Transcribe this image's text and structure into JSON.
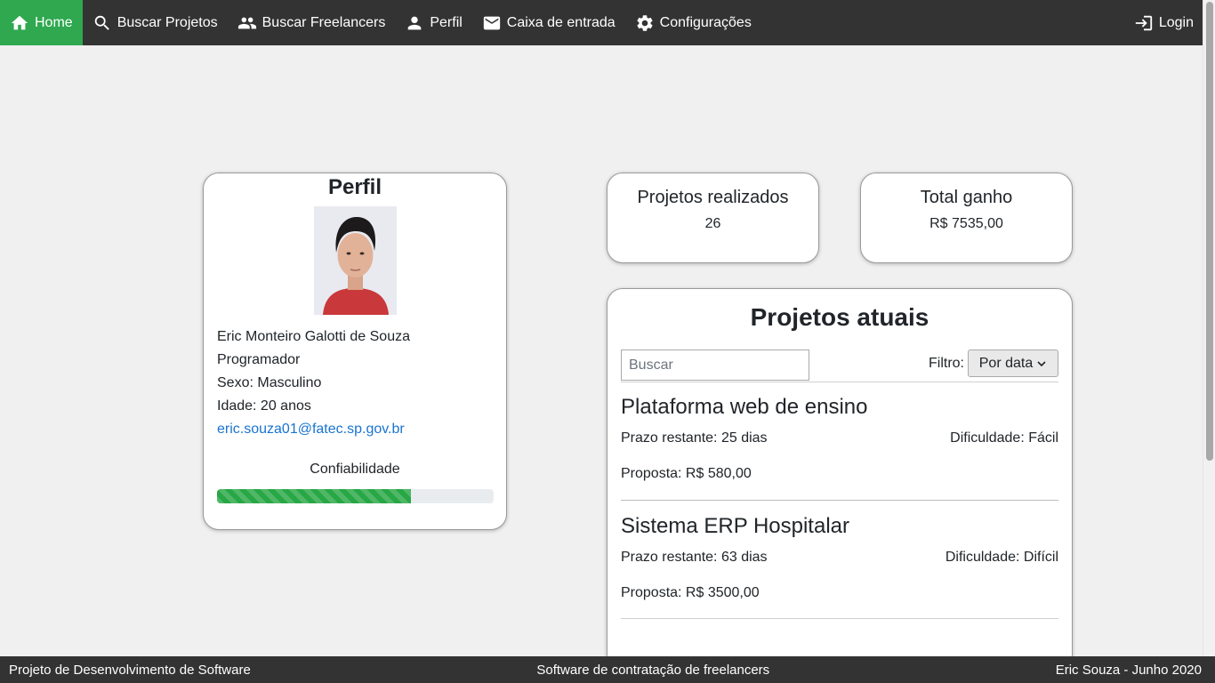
{
  "nav": {
    "home": "Home",
    "search_projects": "Buscar Projetos",
    "search_freelancers": "Buscar Freelancers",
    "profile": "Perfil",
    "inbox": "Caixa de entrada",
    "settings": "Configurações",
    "login": "Login",
    "active_color": "#2fa84f",
    "bar_color": "#333333"
  },
  "profile": {
    "title": "Perfil",
    "name": "Eric Monteiro Galotti de Souza",
    "role": "Programador",
    "gender": "Sexo: Masculino",
    "age": "Idade: 20 anos",
    "email": "eric.souza01@fatec.sp.gov.br",
    "reliability_label": "Confiabilidade",
    "reliability_fraction": 0.7
  },
  "stats": {
    "projects_title": "Projetos realizados",
    "projects_value": "26",
    "earnings_title": "Total ganho",
    "earnings_value": "R$ 7535,00"
  },
  "current_projects": {
    "title": "Projetos atuais",
    "search_placeholder": "Buscar",
    "filter_label": "Filtro:",
    "filter_value": "Por data",
    "items": [
      {
        "name": "Plataforma web de ensino",
        "deadline": "Prazo restante: 25 dias",
        "difficulty": "Dificuldade: Fácil",
        "bid": "Proposta: R$ 580,00"
      },
      {
        "name": "Sistema ERP Hospitalar",
        "deadline": "Prazo restante: 63 dias",
        "difficulty": "Dificuldade: Difícil",
        "bid": "Proposta: R$ 3500,00"
      }
    ]
  },
  "footer": {
    "left": "Projeto de Desenvolvimento de Software",
    "center": "Software de contratação de freelancers",
    "right": "Eric Souza - Junho 2020"
  }
}
